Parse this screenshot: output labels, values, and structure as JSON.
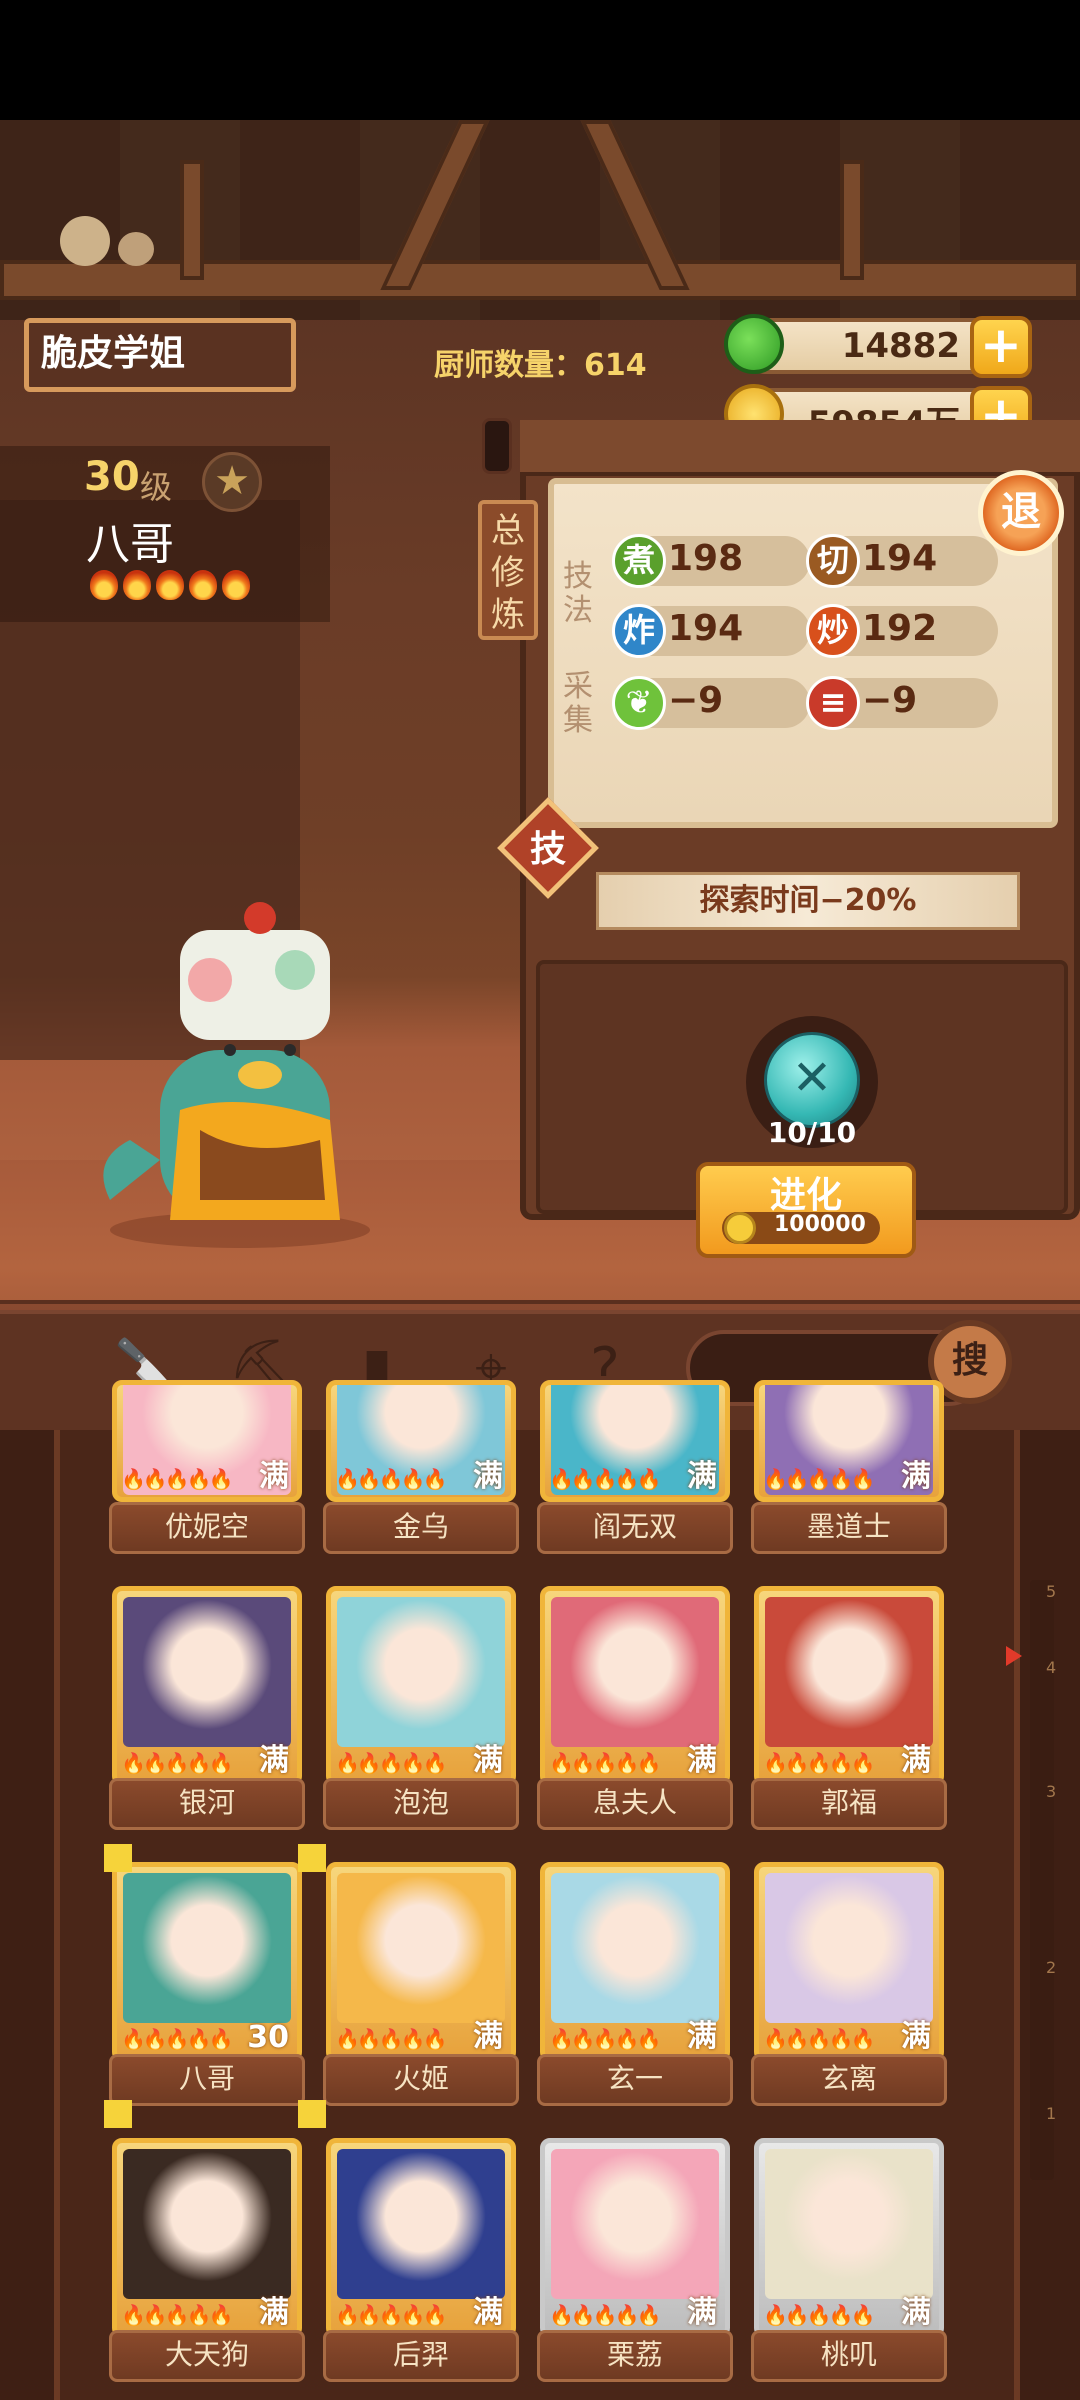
{
  "player": {
    "name": "脆皮学姐"
  },
  "header": {
    "chef_count": "厨师数量：614"
  },
  "currency": {
    "jade": "14882",
    "coins": "59854万"
  },
  "character": {
    "level": "30",
    "level_unit": "级",
    "name": "八哥",
    "flames": 5
  },
  "training_panel": {
    "tag": "总修炼",
    "technique_label": "技法",
    "gather_label": "采集",
    "stats": [
      {
        "icon": "煮",
        "value": "198",
        "color": "#5aa02c"
      },
      {
        "icon": "切",
        "value": "194",
        "color": "#9a5a22"
      },
      {
        "icon": "炸",
        "value": "194",
        "color": "#2f86c9"
      },
      {
        "icon": "炒",
        "value": "192",
        "color": "#d8501c"
      },
      {
        "icon": "cabbage-icon",
        "value": "−9",
        "color": "#6fc23b"
      },
      {
        "icon": "meat-icon",
        "value": "−9",
        "color": "#c93a2a"
      }
    ],
    "back": "退",
    "skill": "技",
    "explore": "探索时间−20%"
  },
  "evolve": {
    "fragments": "10/10",
    "label": "进化",
    "cost": "100000"
  },
  "toolbar": {
    "search": "搜"
  },
  "scroll_ticks": [
    "5",
    "4",
    "3",
    "2",
    "1"
  ],
  "grid": {
    "full_label": "满",
    "cards": [
      {
        "name": "优妮空",
        "badge": "满",
        "tone": "#f7b7c4"
      },
      {
        "name": "金乌",
        "badge": "满",
        "tone": "#7fc7d8"
      },
      {
        "name": "阎无双",
        "badge": "满",
        "tone": "#4ab6c9"
      },
      {
        "name": "墨道士",
        "badge": "满",
        "tone": "#8f6fb4"
      },
      {
        "name": "银河",
        "badge": "满",
        "tone": "#5a4a7a"
      },
      {
        "name": "泡泡",
        "badge": "满",
        "tone": "#8fd3d9"
      },
      {
        "name": "息夫人",
        "badge": "满",
        "tone": "#e06a78"
      },
      {
        "name": "郭福",
        "badge": "满",
        "tone": "#c94a3a"
      },
      {
        "name": "八哥",
        "badge": "30",
        "tone": "#4aa595"
      },
      {
        "name": "火姬",
        "badge": "满",
        "tone": "#f5b84a"
      },
      {
        "name": "玄一",
        "badge": "满",
        "tone": "#a9d9e6"
      },
      {
        "name": "玄离",
        "badge": "满",
        "tone": "#d9c8e6"
      },
      {
        "name": "大天狗",
        "badge": "满",
        "tone": "#3a2a22"
      },
      {
        "name": "后羿",
        "badge": "满",
        "tone": "#2f3f8f"
      },
      {
        "name": "栗荔",
        "badge": "满",
        "tone": "#f4a6b8"
      },
      {
        "name": "桃叽",
        "badge": "满",
        "tone": "#e9e2c9"
      }
    ]
  }
}
